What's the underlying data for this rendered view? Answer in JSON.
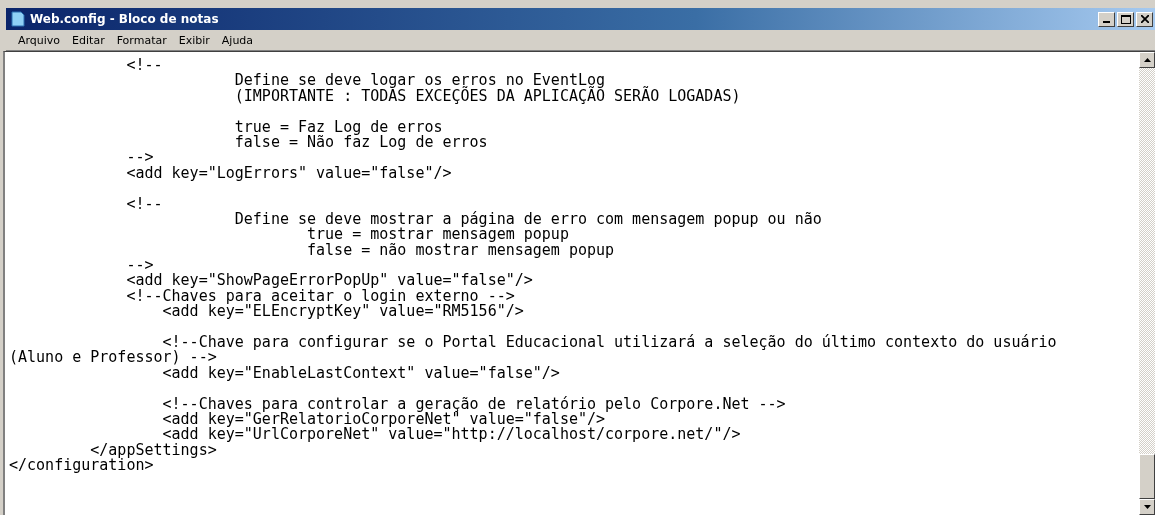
{
  "window": {
    "title": "Web.config - Bloco de notas"
  },
  "menu": [
    "Arquivo",
    "Editar",
    "Formatar",
    "Exibir",
    "Ajuda"
  ],
  "lines": [
    {
      "kind": "text",
      "text": "             <!--"
    },
    {
      "kind": "text",
      "text": "                         Define se deve logar os erros no EventLog"
    },
    {
      "kind": "text",
      "text": "                         (IMPORTANTE : TODAS EXCEÇÕES DA APLICAÇÃO SERÃO LOGADAS)"
    },
    {
      "kind": "blank"
    },
    {
      "kind": "text",
      "text": "                         true = Faz Log de erros"
    },
    {
      "kind": "text",
      "text": "                         false = Não faz Log de erros"
    },
    {
      "kind": "text",
      "text": "             -->"
    },
    {
      "kind": "text",
      "text": "             <add key=\"LogErrors\" value=\"false\"/>"
    },
    {
      "kind": "blank"
    },
    {
      "kind": "text",
      "text": "             <!--"
    },
    {
      "kind": "text",
      "text": "                         Define se deve mostrar a página de erro com mensagem popup ou não"
    },
    {
      "kind": "text",
      "text": "                                 true = mostrar mensagem popup"
    },
    {
      "kind": "text",
      "text": "                                 false = não mostrar mensagem popup"
    },
    {
      "kind": "text",
      "text": "             -->"
    },
    {
      "kind": "text",
      "text": "             <add key=\"ShowPageErrorPopUp\" value=\"false\"/>"
    },
    {
      "kind": "text",
      "text": "             <!--Chaves para aceitar o login externo -->"
    },
    {
      "kind": "text",
      "text": "                 <add key=\"ELEncryptKey\" value=\"RM5156\"/>"
    },
    {
      "kind": "blank"
    },
    {
      "kind": "text",
      "text": "                 <!--Chave para configurar se o Portal Educacional utilizará a seleção do último contexto do usuário"
    },
    {
      "kind": "text",
      "text": "(Aluno e Professor) -->"
    },
    {
      "kind": "text",
      "text": "                 <add key=\"EnableLastContext\" value=\"false\"/>"
    },
    {
      "kind": "blank"
    },
    {
      "kind": "text",
      "text": "                 <!--Chaves para controlar a geração de relatório pelo Corpore.Net -->"
    },
    {
      "kind": "text",
      "text": "                 <add key=\"GerRelatorioCorporeNet\" value=\"false\"/>"
    },
    {
      "kind": "text",
      "text": "                 <add key=\"UrlCorporeNet\" value=\"http://localhost/corpore.net/\"/>"
    },
    {
      "kind": "text",
      "text": "         </appSettings>"
    },
    {
      "kind": "text",
      "text": "</configuration>"
    }
  ]
}
